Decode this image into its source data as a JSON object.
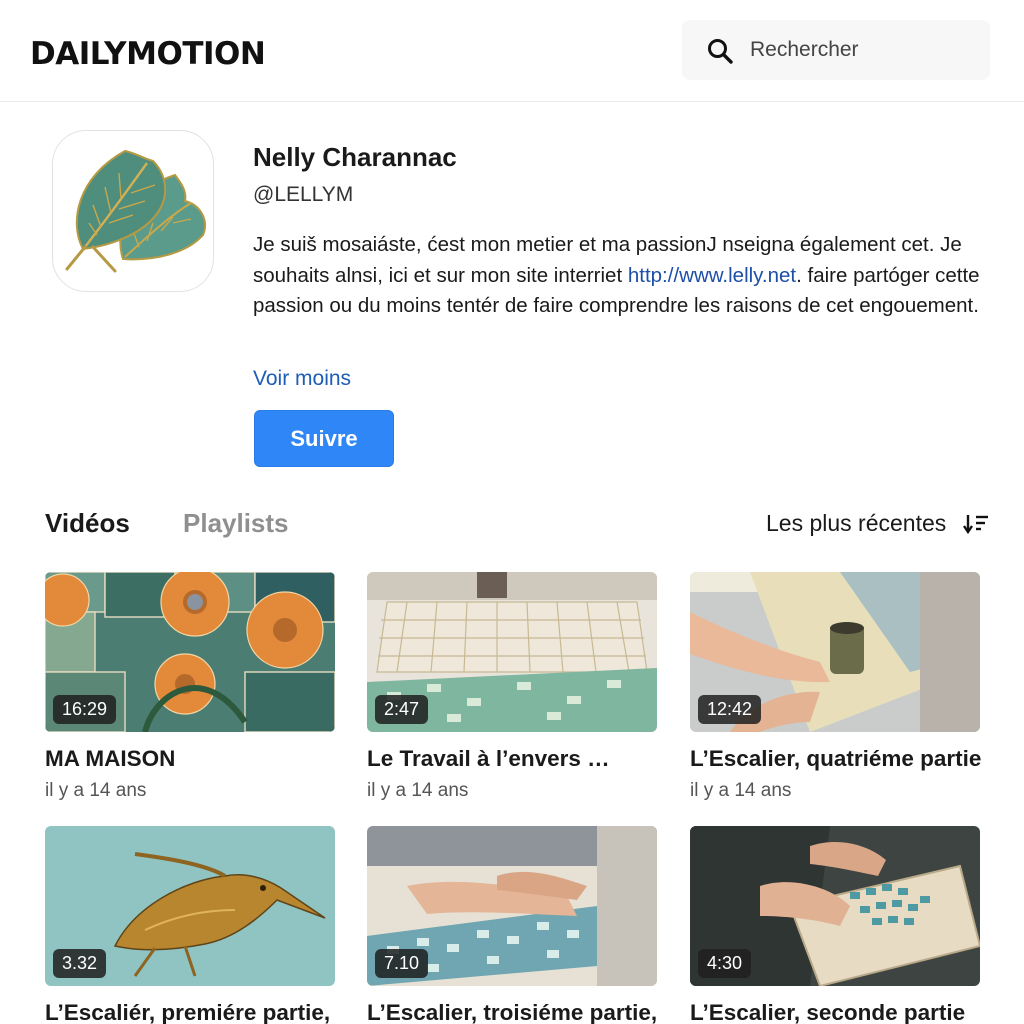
{
  "header": {
    "logo": "DAILYMOTION",
    "search_placeholder": "Rechercher"
  },
  "channel": {
    "name": "Nelly Charannac",
    "handle": "@LELLYM",
    "bio_part1": "Je suiš mosaiáste, ćest mon metier et ma passionJ nseigna également cet. Je souhaits alnsi, ici et sur mon site interriet ",
    "bio_link": "http://www.lelly.net",
    "bio_part2": ". faire partóger cette passion ou du moins tentér de faire comprendre les rais­ons de cet engouement.",
    "see_less": "Voir moins",
    "follow": "Suivre"
  },
  "tabs": {
    "videos": "Vidéos",
    "playlists": "Playlists",
    "active": "videos"
  },
  "sort": {
    "label": "Les plus récentes"
  },
  "videos": [
    {
      "title": "MA MAISON",
      "date": "il y a 14 ans",
      "duration": "16:29"
    },
    {
      "title": "Le Travail à l’envers …",
      "date": "il y a 14 ans",
      "duration": "2:47"
    },
    {
      "title": "L’Escalier, quatriéme partie",
      "date": "il y a 14 ans",
      "duration": "12:42"
    },
    {
      "title": "L’Escaliér, premiére partie,",
      "date": "",
      "duration": "3.32"
    },
    {
      "title": "L’Escalier, troisiéme partie,",
      "date": "",
      "duration": "7.10"
    },
    {
      "title": "L’Escalier, seconde partie",
      "date": "",
      "duration": "4:30"
    }
  ]
}
